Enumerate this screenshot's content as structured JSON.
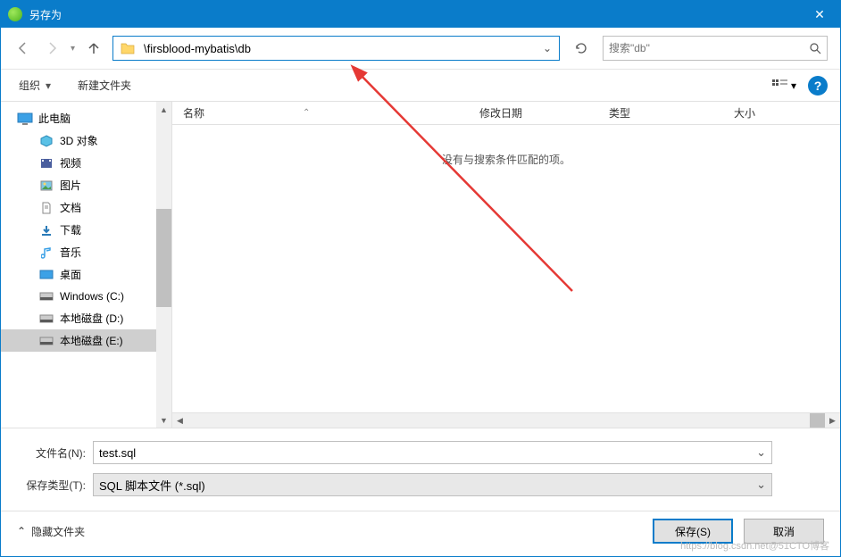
{
  "window": {
    "title": "另存为"
  },
  "address": {
    "path": "\\firsblood-mybatis\\db"
  },
  "search": {
    "placeholder": "搜索\"db\""
  },
  "toolbar": {
    "organize": "组织",
    "newfolder": "新建文件夹"
  },
  "columns": {
    "name": "名称",
    "modified": "修改日期",
    "type": "类型",
    "size": "大小"
  },
  "empty": "没有与搜索条件匹配的项。",
  "sidebar": {
    "root": "此电脑",
    "items": [
      {
        "label": "3D 对象"
      },
      {
        "label": "视频"
      },
      {
        "label": "图片"
      },
      {
        "label": "文档"
      },
      {
        "label": "下载"
      },
      {
        "label": "音乐"
      },
      {
        "label": "桌面"
      },
      {
        "label": "Windows (C:)"
      },
      {
        "label": "本地磁盘 (D:)"
      },
      {
        "label": "本地磁盘 (E:)"
      }
    ]
  },
  "form": {
    "filename_label": "文件名(N):",
    "filename_value": "test.sql",
    "filetype_label": "保存类型(T):",
    "filetype_value": "SQL 脚本文件 (*.sql)"
  },
  "footer": {
    "hide": "隐藏文件夹",
    "save": "保存(S)",
    "cancel": "取消"
  },
  "watermark": "https://blog.csdn.net@51CTO博客"
}
